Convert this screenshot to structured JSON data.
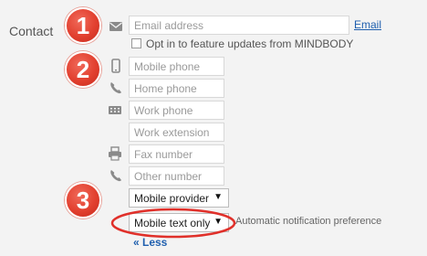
{
  "contact": {
    "section_label": "Contact",
    "email": {
      "placeholder": "Email address",
      "link_label": "Email"
    },
    "opt_in_label": "Opt in to feature updates from MINDBODY",
    "mobile_phone": {
      "placeholder": "Mobile phone"
    },
    "home_phone": {
      "placeholder": "Home phone"
    },
    "work_phone": {
      "placeholder": "Work phone"
    },
    "work_extension": {
      "placeholder": "Work extension"
    },
    "fax_number": {
      "placeholder": "Fax number"
    },
    "other_number": {
      "placeholder": "Other number"
    },
    "mobile_provider": {
      "selected": "Mobile provider"
    },
    "notification": {
      "selected": "Mobile text only",
      "hint": "Automatic notification preference"
    },
    "less_link": "« Less"
  },
  "annotations": {
    "badges": [
      "1",
      "2",
      "3"
    ],
    "badge_color": "#e2402f",
    "highlight_color": "#e0302a"
  },
  "icons": [
    "envelope-icon",
    "mobile-phone-icon",
    "phone-icon",
    "keypad-phone-icon",
    "fax-icon",
    "phone-icon"
  ]
}
